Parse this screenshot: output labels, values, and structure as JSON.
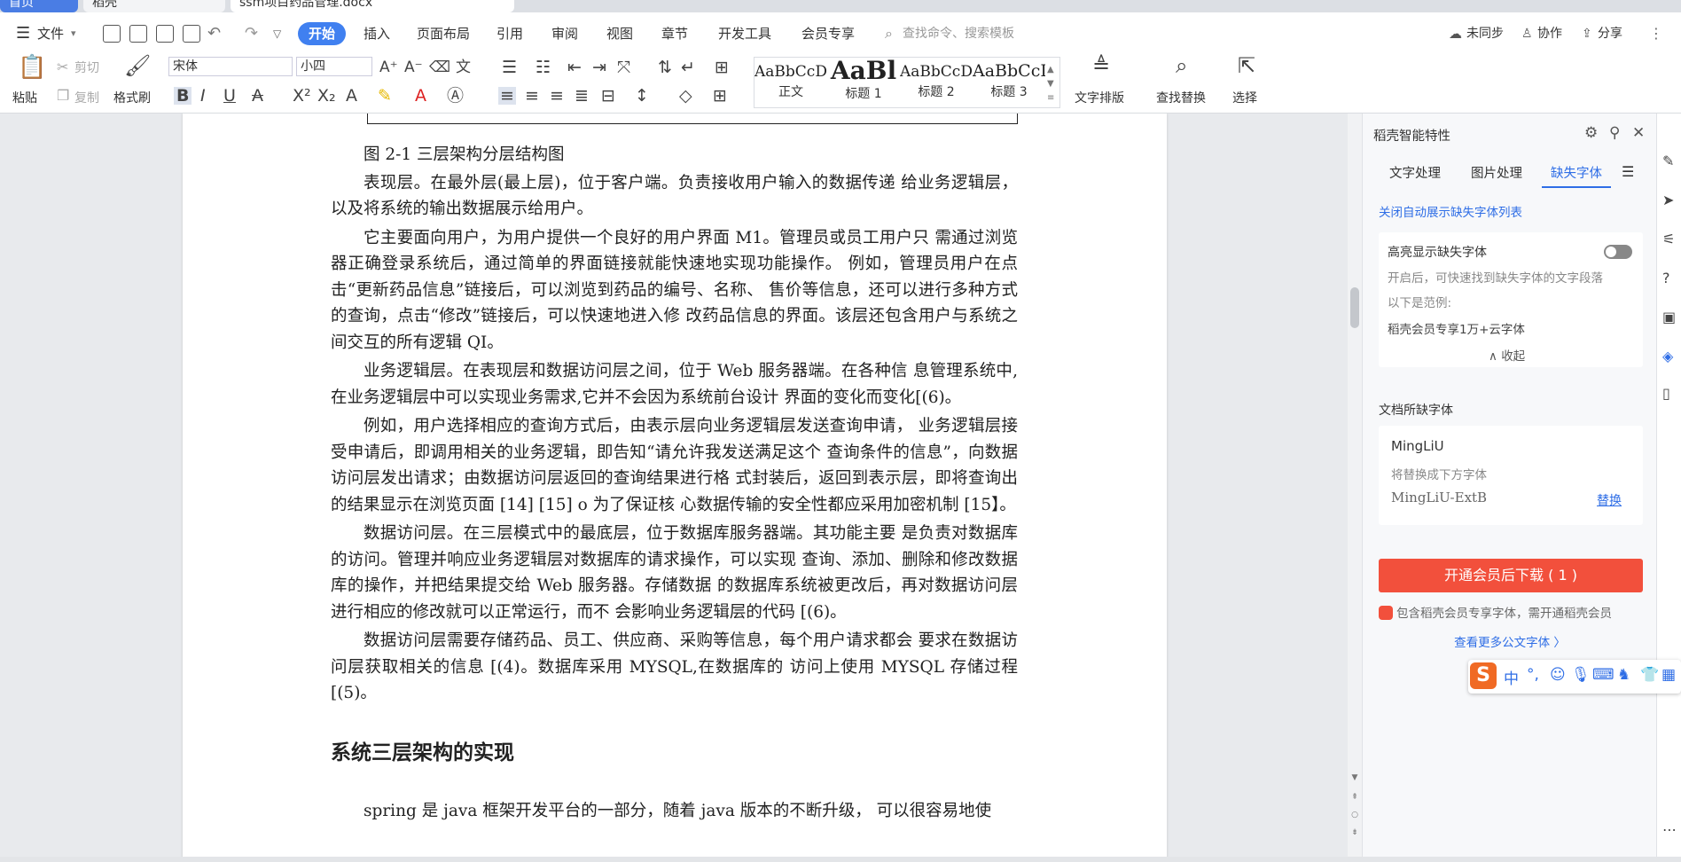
{
  "tabs": {
    "home": "首页",
    "daoke": "稻壳",
    "doc": "ssm项目药品管理.docx"
  },
  "menu": {
    "file": "文件",
    "items": [
      "开始",
      "插入",
      "页面布局",
      "引用",
      "审阅",
      "视图",
      "章节",
      "开发工具",
      "会员专享"
    ],
    "search_placeholder": "查找命令、搜索模板",
    "sync": "未同步",
    "collab": "协作",
    "share": "分享"
  },
  "ribbon": {
    "paste": "粘贴",
    "cut": "剪切",
    "copy": "复制",
    "format_painter": "格式刷",
    "font_name": "宋体",
    "font_size": "小四",
    "styles": [
      {
        "preview": "AaBbCcDd",
        "label": "正文"
      },
      {
        "preview": "AaBl",
        "label": "标题 1"
      },
      {
        "preview": "AaBbCcDd",
        "label": "标题 2"
      },
      {
        "preview": "AaBbCcI",
        "label": "标题 3"
      }
    ],
    "text_layout": "文字排版",
    "find_replace": "查找替换",
    "select": "选择"
  },
  "document": {
    "caption": "图 2-1 三层架构分层结构图",
    "paragraphs": [
      "表现层。在最外层(最上层)，位于客户端。负责接收用户输入的数据传递 给业务逻辑层，以及将系统的输出数据展示给用户。",
      "它主要面向用户，为用户提供一个良好的用户界面 M1。管理员或员工用户只 需通过浏览器正确登录系统后，通过简单的界面链接就能快速地实现功能操作。 例如，管理员用户在点击“更新药品信息”链接后，可以浏览到药品的编号、名称、 售价等信息，还可以进行多种方式的查询，点击“修改”链接后，可以快速地进入修 改药品信息的界面。该层还包含用户与系统之间交互的所有逻辑 QI。",
      "业务逻辑层。在表现层和数据访问层之间，位于 Web 服务器端。在各种信 息管理系统中,在业务逻辑层中可以实现业务需求,它并不会因为系统前台设计 界面的变化而变化[(6)。",
      "例如，用户选择相应的查询方式后，由表示层向业务逻辑层发送查询申请， 业务逻辑层接受申请后，即调用相关的业务逻辑，即告知“请允许我发送满足这个 查询条件的信息”，向数据访问层发出请求；由数据访问层返回的查询结果进行格 式封装后，返回到表示层，即将查询出的结果显示在浏览页面 [14] [15] o 为了保证核 心数据传输的安全性都应采用加密机制 [15】。",
      "数据访问层。在三层模式中的最底层，位于数据库服务器端。其功能主要 是负责对数据库的访问。管理并响应业务逻辑层对数据库的请求操作，可以实现 查询、添加、删除和修改数据库的操作，并把结果提交给 Web 服务器。存储数据 的数据库系统被更改后，再对数据访问层进行相应的修改就可以正常运行，而不 会影响业务逻辑层的代码 [(6)。",
      "数据访问层需要存储药品、员工、供应商、采购等信息，每个用户请求都会 要求在数据访问层获取相关的信息 [(4)。数据库采用 MYSQL,在数据库的 访问上使用 MYSQL 存储过程 [(5)。"
    ],
    "heading": "系统三层架构的实现",
    "last_paragraph": "spring 是 java 框架开发平台的一部分，随着 java 版本的不断升级， 可以很容易地使"
  },
  "panel": {
    "title": "稻壳智能特性",
    "tabs": [
      "文字处理",
      "图片处理",
      "缺失字体"
    ],
    "close_auto_link": "关闭自动展示缺失字体列表",
    "highlight_title": "高亮显示缺失字体",
    "highlight_desc": "开启后，可快速找到缺失字体的文字段落",
    "example_label": "以下是范例:",
    "example_text": "稻壳会员专享1万+云字体",
    "collapse": "收起",
    "missing_section": "文档所缺字体",
    "missing_font": "MingLiU",
    "replace_hint": "将替换成下方字体",
    "replacement_font": "MingLiU-ExtB",
    "replace_link": "替换",
    "download_button": "开通会员后下载 ( 1 )",
    "member_note": "包含稻壳会员专享字体，需开通稻壳会员",
    "more_fonts": "查看更多公文字体 〉"
  },
  "ime": {
    "logo": "S",
    "mode": "中"
  }
}
